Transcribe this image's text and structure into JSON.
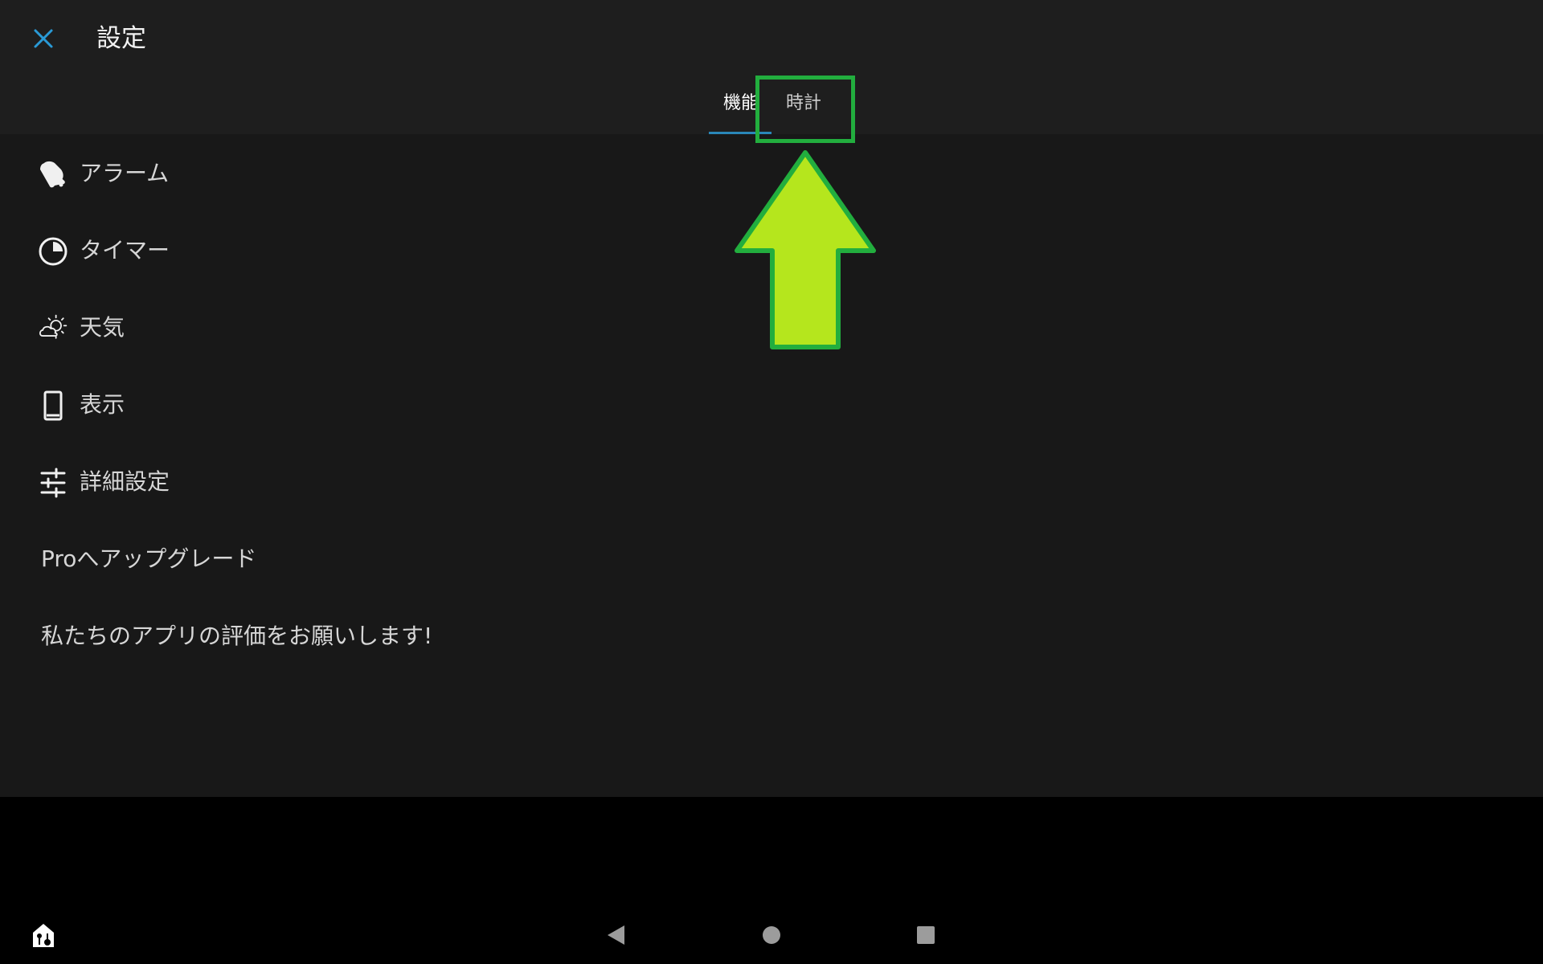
{
  "header": {
    "title": "設定",
    "close_icon": "close-icon"
  },
  "tabs": [
    {
      "label": "機能",
      "selected": true
    },
    {
      "label": "時計",
      "selected": false,
      "highlighted": true
    }
  ],
  "menu": [
    {
      "label": "アラーム",
      "icon": "alarm-bell-icon"
    },
    {
      "label": "タイマー",
      "icon": "timer-icon"
    },
    {
      "label": "天気",
      "icon": "weather-icon"
    },
    {
      "label": "表示",
      "icon": "display-phone-icon"
    },
    {
      "label": "詳細設定",
      "icon": "sliders-icon"
    },
    {
      "label": "Proへアップグレード"
    },
    {
      "label": "私たちのアプリの評価をお願いします!"
    }
  ],
  "annotation": {
    "arrow_color": "#b5e61d",
    "box_color": "#22ae3e"
  },
  "colors": {
    "accent": "#2a87b8",
    "background": "#181818",
    "topbar": "#1e1e1e"
  },
  "navbar": {
    "icons": [
      "accessibility-icon",
      "back-icon",
      "home-icon",
      "recents-icon"
    ]
  }
}
